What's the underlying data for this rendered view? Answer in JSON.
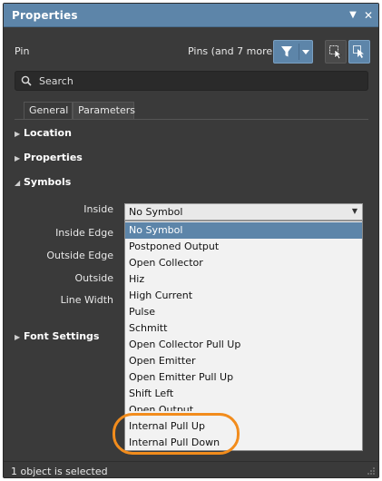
{
  "window": {
    "title": "Properties",
    "pin_menu_icon": "dropdown-arrow-icon",
    "close_icon": "close-icon"
  },
  "header": {
    "object_type": "Pin",
    "filter_summary": "Pins (and 7 more)"
  },
  "search": {
    "placeholder": "Search"
  },
  "tabs": [
    {
      "label": "General",
      "active": true
    },
    {
      "label": "Parameters",
      "active": false
    }
  ],
  "sections": {
    "location": "Location",
    "properties": "Properties",
    "symbols": "Symbols",
    "font_settings": "Font Settings"
  },
  "symbols": {
    "labels": {
      "inside": "Inside",
      "inside_edge": "Inside Edge",
      "outside_edge": "Outside Edge",
      "outside": "Outside",
      "line_width": "Line Width"
    },
    "inside_value": "No Symbol",
    "options": [
      "No Symbol",
      "Postponed Output",
      "Open Collector",
      "Hiz",
      "High Current",
      "Pulse",
      "Schmitt",
      "Open Collector Pull Up",
      "Open Emitter",
      "Open Emitter Pull Up",
      "Shift Left",
      "Open Output",
      "Internal Pull Up",
      "Internal Pull Down"
    ],
    "selected_option": "No Symbol"
  },
  "status": {
    "text": "1 object is selected"
  },
  "colors": {
    "accent": "#5d85a9",
    "panel_bg": "#3a3a3a",
    "highlight": "#f28c1c"
  }
}
